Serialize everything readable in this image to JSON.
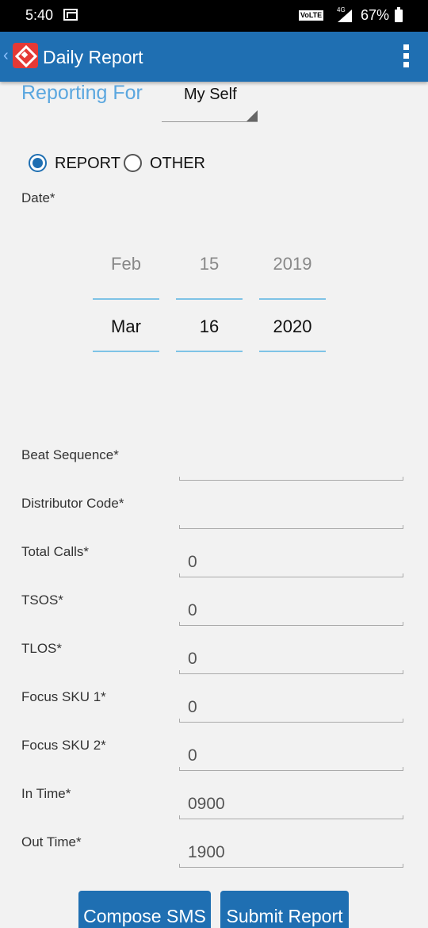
{
  "status_bar": {
    "time": "5:40",
    "network": "VoLTE",
    "network_type": "4G",
    "battery": "67%"
  },
  "app_bar": {
    "title": "Daily Report",
    "back_glyph": "‹"
  },
  "reporting_for": {
    "label": "Reporting For",
    "selected": "My Self"
  },
  "report_type": {
    "options": [
      {
        "label": "REPORT",
        "checked": true
      },
      {
        "label": "OTHER",
        "checked": false
      }
    ]
  },
  "date": {
    "label": "Date*",
    "previous": {
      "month": "Feb",
      "day": "15",
      "year": "2019"
    },
    "selected": {
      "month": "Mar",
      "day": "16",
      "year": "2020"
    }
  },
  "fields": [
    {
      "label": "Beat Sequence*",
      "value": ""
    },
    {
      "label": "Distributor Code*",
      "value": ""
    },
    {
      "label": "Total Calls*",
      "value": "0"
    },
    {
      "label": "TSOS*",
      "value": "0"
    },
    {
      "label": "TLOS*",
      "value": "0"
    },
    {
      "label": "Focus SKU 1*",
      "value": "0"
    },
    {
      "label": "Focus SKU 2*",
      "value": "0"
    },
    {
      "label": "In Time*",
      "value": "0900"
    },
    {
      "label": "Out Time*",
      "value": "1900"
    }
  ],
  "buttons": {
    "compose": "Compose SMS",
    "submit": "Submit Report"
  },
  "colors": {
    "app_bar": "#1f6fb2",
    "accent_text": "#5ba7df",
    "picker_line": "#7ec3e6",
    "logo": "#e53935"
  }
}
